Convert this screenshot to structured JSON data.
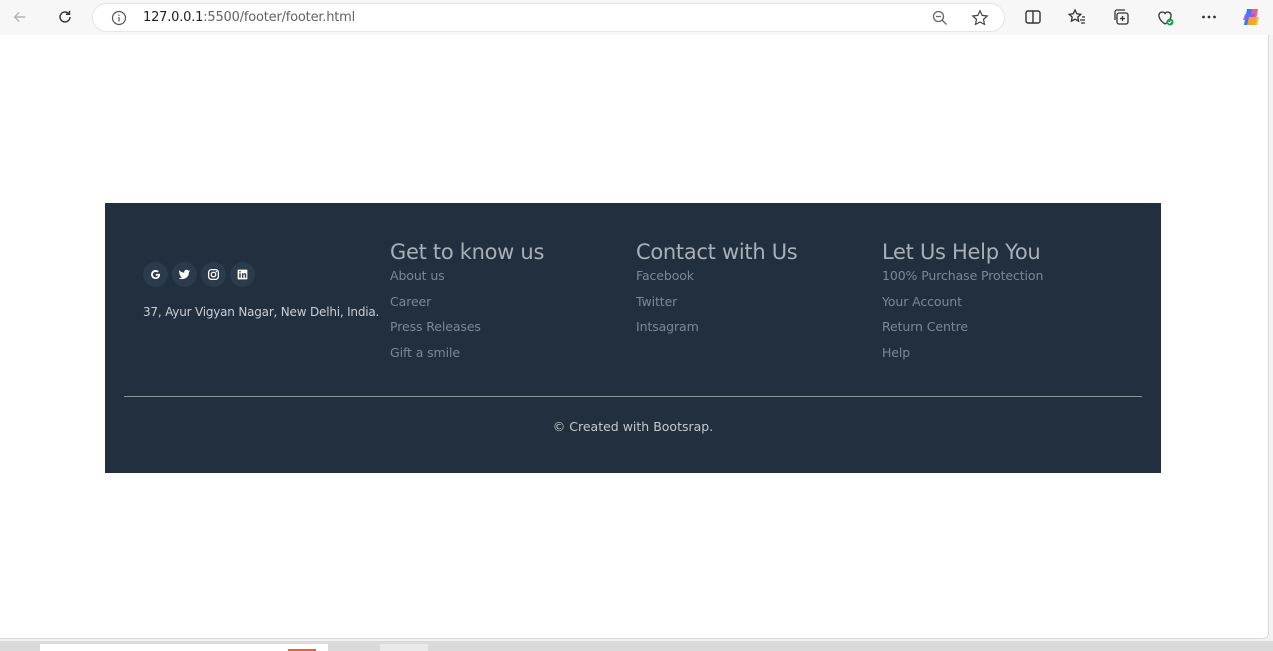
{
  "browser": {
    "url_host": "127.0.0.1",
    "url_rest": ":5500/footer/footer.html",
    "icons": [
      "back-arrow-icon",
      "reload-icon",
      "info-icon",
      "zoom-out-icon",
      "star-icon",
      "split-screen-icon",
      "favorites-icon",
      "collections-icon",
      "browser-essentials-icon",
      "more-icon",
      "copilot-icon"
    ]
  },
  "footer": {
    "social_icons": [
      "google-icon",
      "twitter-icon",
      "instagram-icon",
      "linkedin-icon"
    ],
    "address": "37, Ayur Vigyan Nagar, New Delhi, India.",
    "columns": [
      {
        "title": "Get to know us",
        "links": [
          "About us",
          "Career",
          "Press Releases",
          "Gift a smile"
        ]
      },
      {
        "title": "Contact with Us",
        "links": [
          "Facebook",
          "Twitter",
          "Intsagram"
        ]
      },
      {
        "title": "Let Us Help You",
        "links": [
          "100% Purchase Protection",
          "Your Account",
          "Return Centre",
          "Help"
        ]
      }
    ],
    "copyright": "© Created with Bootsrap.",
    "colors": {
      "background": "#222f3e",
      "heading": "#a7afb9",
      "link": "#7d8794"
    }
  }
}
